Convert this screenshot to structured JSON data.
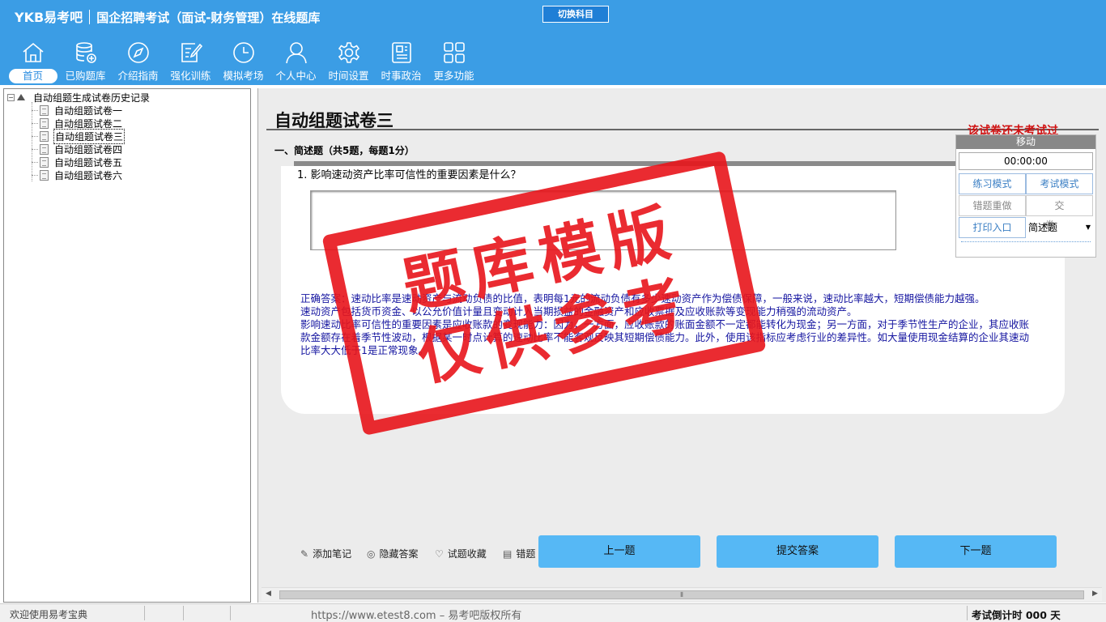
{
  "header": {
    "brand": "YKB易考吧",
    "title": "国企招聘考试（面试-财务管理）在线题库",
    "switch_subject": "切换科目"
  },
  "nav": {
    "items": [
      {
        "label": "首页",
        "icon": "home-icon"
      },
      {
        "label": "已购题库",
        "icon": "database-icon"
      },
      {
        "label": "介绍指南",
        "icon": "compass-icon"
      },
      {
        "label": "强化训练",
        "icon": "edit-icon"
      },
      {
        "label": "模拟考场",
        "icon": "clock-icon"
      },
      {
        "label": "个人中心",
        "icon": "user-icon"
      },
      {
        "label": "时间设置",
        "icon": "gear-icon"
      },
      {
        "label": "时事政治",
        "icon": "news-icon"
      },
      {
        "label": "更多功能",
        "icon": "grid-icon"
      }
    ],
    "active": "首页"
  },
  "tree": {
    "root": "自动组题生成试卷历史记录",
    "toggle": "−",
    "items": [
      "自动组题试卷一",
      "自动组题试卷二",
      "自动组题试卷三",
      "自动组题试卷四",
      "自动组题试卷五",
      "自动组题试卷六"
    ],
    "selected": "自动组题试卷三"
  },
  "paper": {
    "title": "自动组题试卷三",
    "status": "该试卷还未考试过",
    "section": "一、简述题（共5题，每题1分）",
    "question": "1. 影响速动资产比率可信性的重要因素是什么？",
    "answer_value": "",
    "solution_lines": [
      "正确答案：速动比率是速动资产与流动负债的比值，表明每1元的流动负债有多少速动资产作为偿债保障，一般来说，速动比率越大，短期偿债能力越强。",
      "速动资产包括货币资金、以公允价值计量且变动计入当期损益的金融资产和应收票据及应收账款等变现能力稍强的流动资产。",
      "影响速动比率可信性的重要因素是应收账款的变现能力：因为，一方面，应收账款的账面金额不一定都能转化为现金；另一方面，对于季节性生产的企业，其应收账款金额存在着季节性波动，根据某一时点计算的速动比率不能客观反映其短期偿债能力。此外，使用该指标应考虑行业的差异性。如大量使用现金结算的企业其速动比率大大低于1是正常现象。"
    ]
  },
  "side_panel": {
    "move": "移动",
    "timer": "00:00:00",
    "practice_mode": "练习模式",
    "exam_mode": "考试模式",
    "redo_wrong": "错题重做",
    "submit": "交卷",
    "print": "打印入口",
    "question_type": "简述题"
  },
  "toolbar": {
    "add_note": "添加笔记",
    "hide_answer": "隐藏答案",
    "favorite": "试题收藏",
    "wrong": "错题",
    "prev": "上一题",
    "submit_answer": "提交答案",
    "next": "下一题"
  },
  "scrollbar": {
    "grip": "⦀"
  },
  "status": {
    "welcome": "欢迎使用易考宝典",
    "copyright": "https://www.etest8.com – 易考吧版权所有",
    "countdown": "考试倒计时 000 天"
  },
  "watermark": {
    "line1": "题库模版",
    "line2": "仅供参考"
  },
  "colors": {
    "header_bg": "#3b9de5",
    "button_blue": "#56b8f5",
    "stamp_red": "#e8151b",
    "solution_text": "#1515a0",
    "status_red": "#d01010"
  }
}
